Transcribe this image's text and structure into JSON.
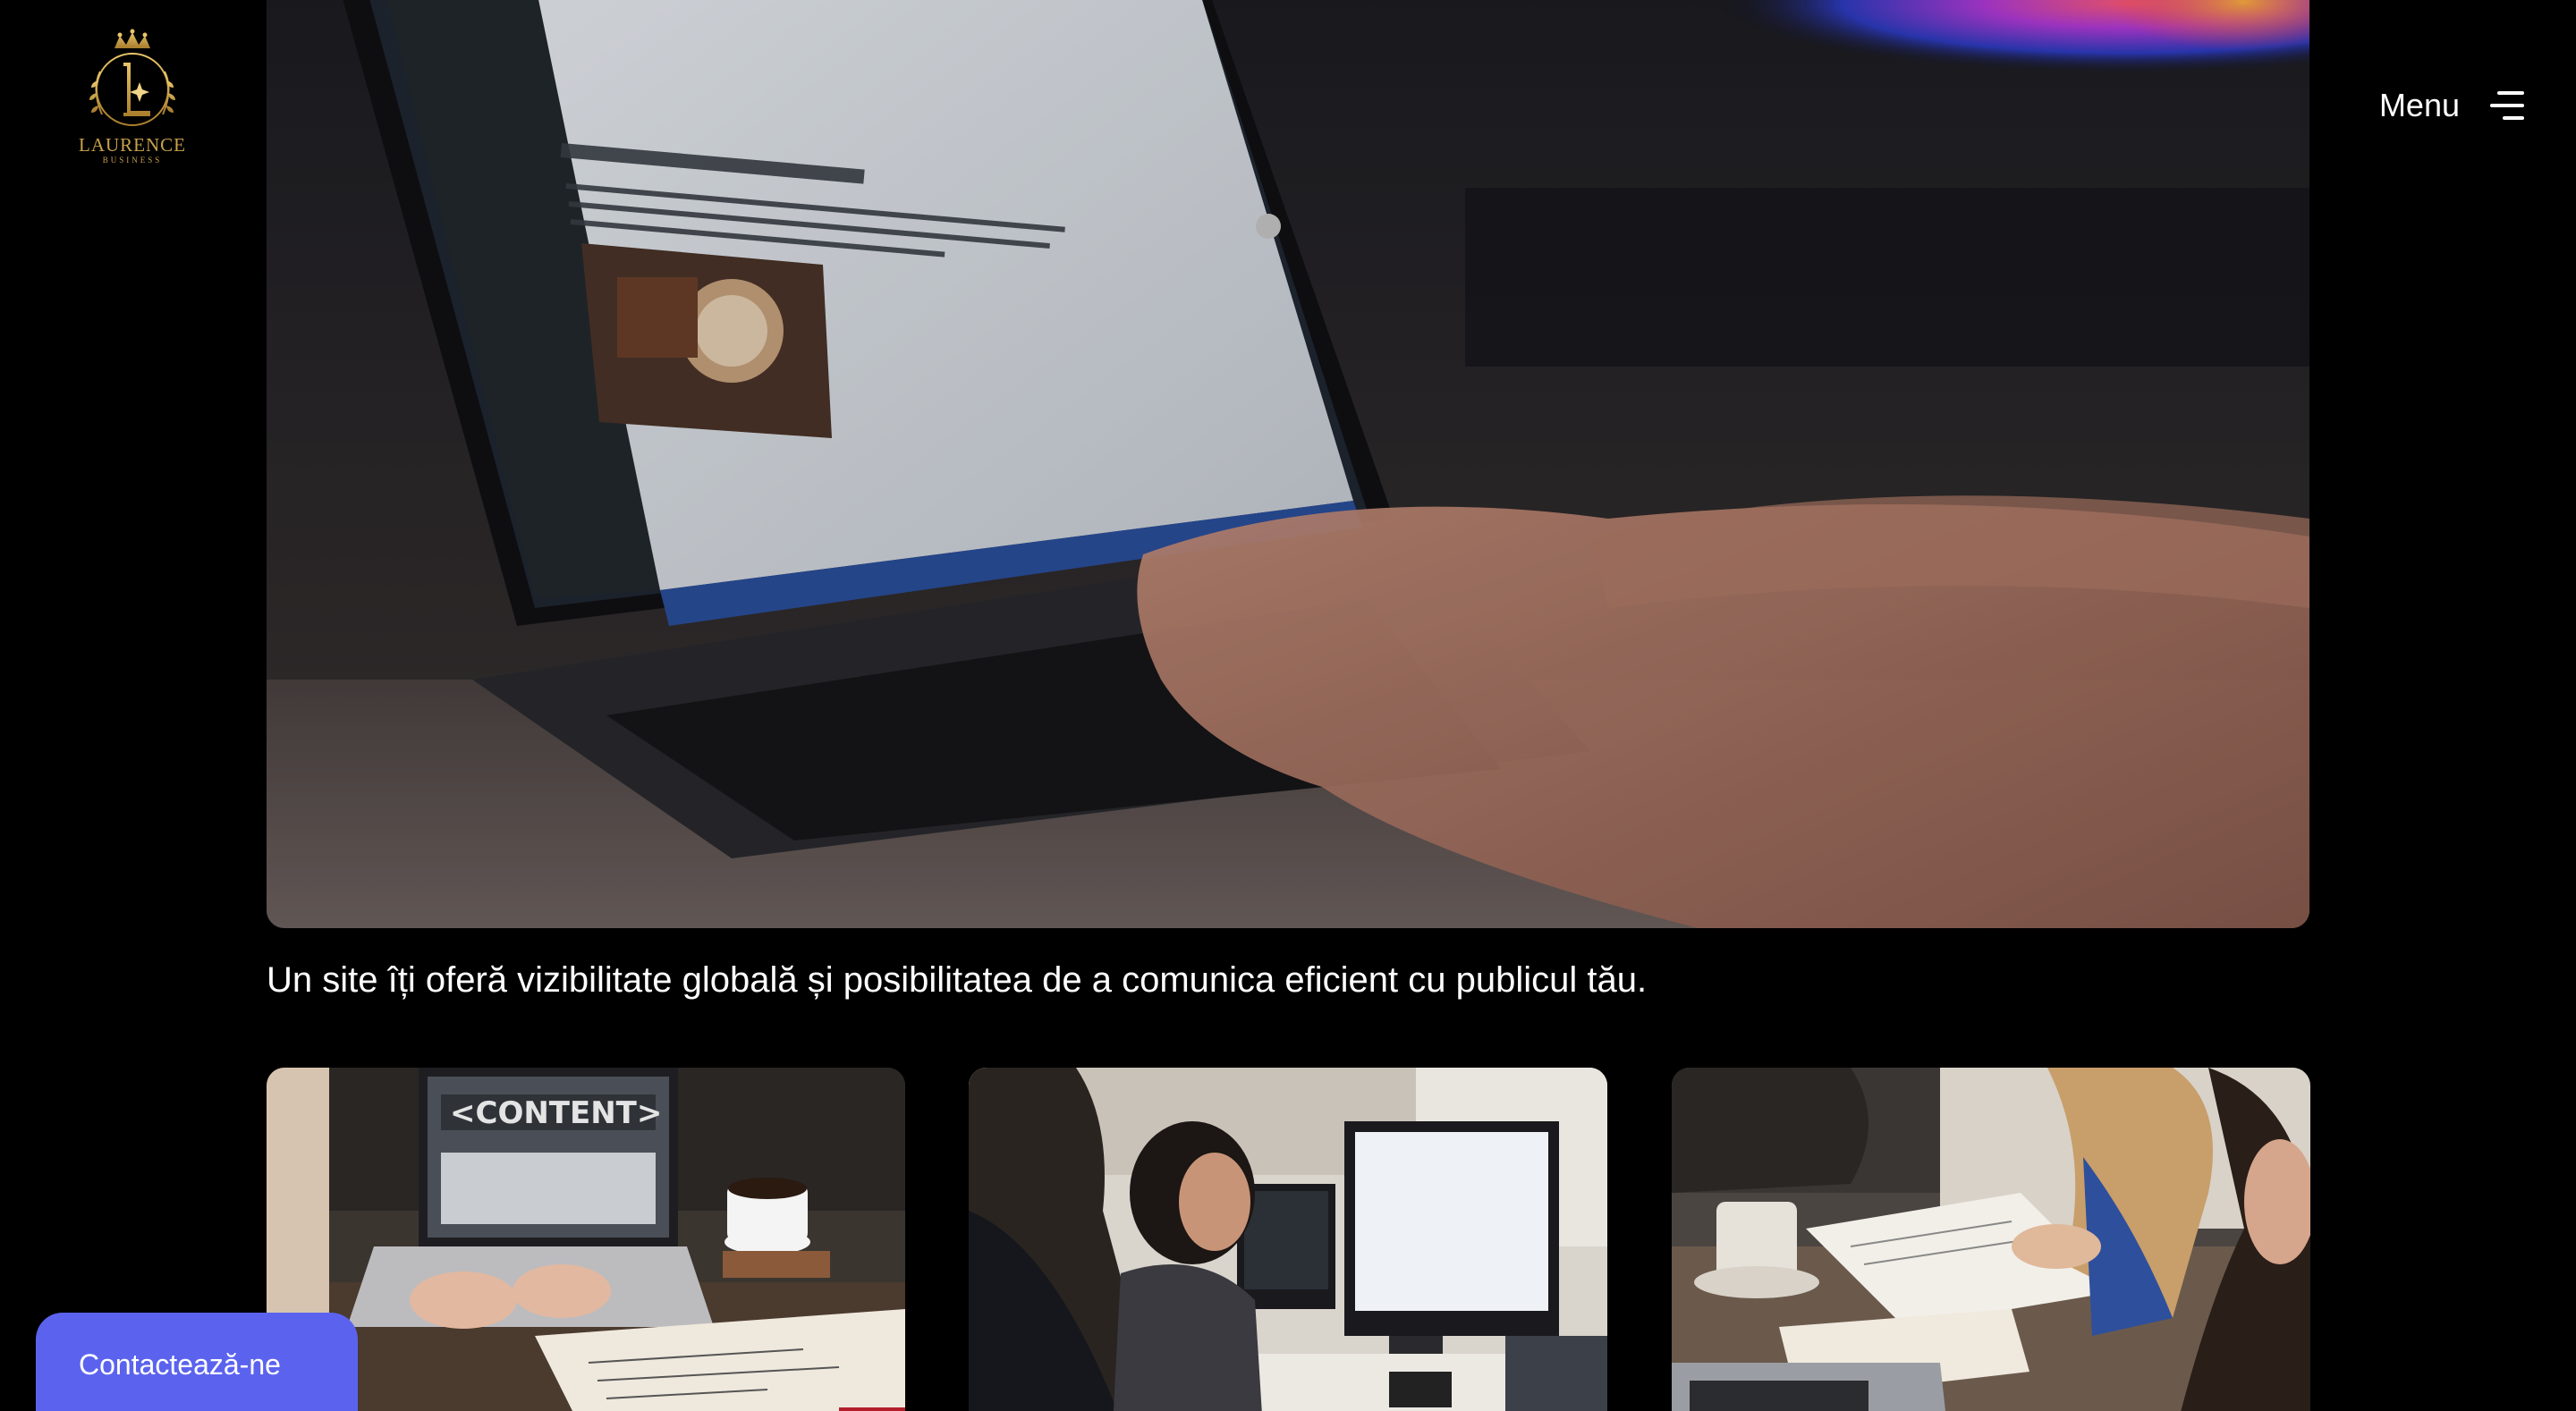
{
  "header": {
    "logo": {
      "brand": "LAURENCE",
      "sub": "BUSINESS",
      "icon": "crown-monogram-icon"
    },
    "menu": {
      "label": "Menu",
      "icon": "hamburger-menu-icon"
    }
  },
  "hero": {
    "image": "laptop-blog-editor-photo",
    "tagline": "Un site îți oferă vizibilitate globală și posibilitatea de a comunica eficient cu publicul tău."
  },
  "cards": [
    {
      "image": "content-laptop-coffee-photo"
    },
    {
      "image": "team-at-computers-photo"
    },
    {
      "image": "meeting-notes-photo"
    }
  ],
  "contact_button": {
    "label": "Contactează-ne"
  },
  "colors": {
    "background": "#000000",
    "text": "#ffffff",
    "accent": "#5b63ee",
    "logo_gold": "#c9a24b"
  }
}
